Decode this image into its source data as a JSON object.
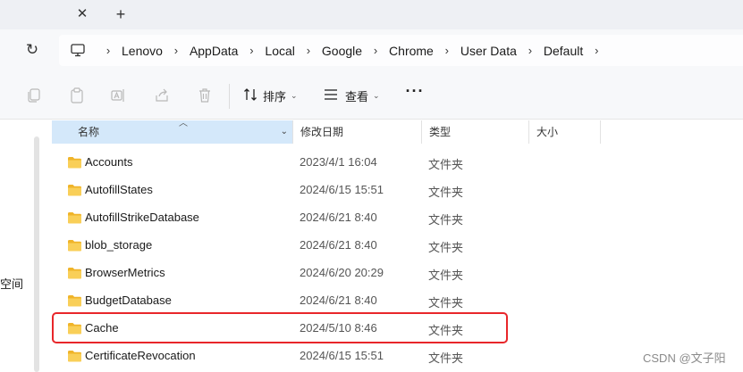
{
  "tabs": {
    "close_icon": "close-icon",
    "new_tab_icon": "plus-icon"
  },
  "address": {
    "refresh_icon": "refresh-icon",
    "computer_icon": "monitor-icon",
    "breadcrumbs": [
      "Lenovo",
      "AppData",
      "Local",
      "Google",
      "Chrome",
      "User Data",
      "Default"
    ]
  },
  "commandbar": {
    "sort_label": "排序",
    "view_label": "查看",
    "more_label": "···"
  },
  "navpane": {
    "partial_label": "空间"
  },
  "columns": {
    "name": "名称",
    "date": "修改日期",
    "type": "类型",
    "size": "大小"
  },
  "files": [
    {
      "name": "Accounts",
      "date": "2023/4/1 16:04",
      "type": "文件夹"
    },
    {
      "name": "AutofillStates",
      "date": "2024/6/15 15:51",
      "type": "文件夹"
    },
    {
      "name": "AutofillStrikeDatabase",
      "date": "2024/6/21 8:40",
      "type": "文件夹"
    },
    {
      "name": "blob_storage",
      "date": "2024/6/21 8:40",
      "type": "文件夹"
    },
    {
      "name": "BrowserMetrics",
      "date": "2024/6/20 20:29",
      "type": "文件夹"
    },
    {
      "name": "BudgetDatabase",
      "date": "2024/6/21 8:40",
      "type": "文件夹"
    },
    {
      "name": "Cache",
      "date": "2024/5/10 8:46",
      "type": "文件夹"
    },
    {
      "name": "CertificateRevocation",
      "date": "2024/6/15 15:51",
      "type": "文件夹"
    }
  ],
  "highlighted_file": "Cache",
  "colors": {
    "highlight_border": "#e8262a",
    "folder": "#f6c443",
    "header_active": "#d4e8fa"
  },
  "watermark": "CSDN @文子阳"
}
